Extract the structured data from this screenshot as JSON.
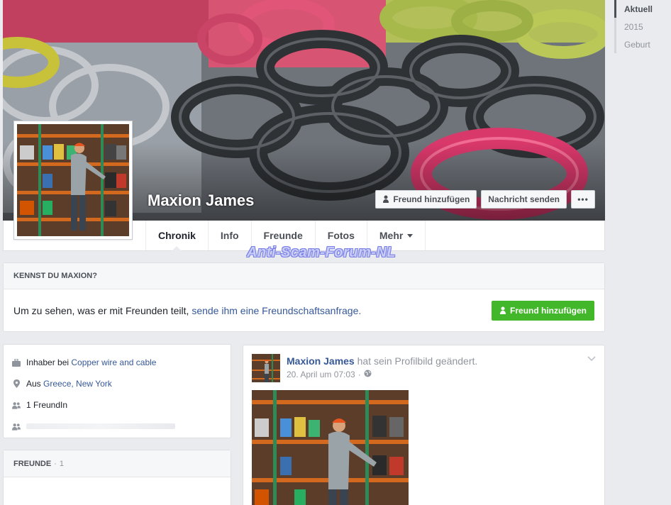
{
  "profile": {
    "name": "Maxion James"
  },
  "cover_actions": {
    "add_friend": "Freund hinzufügen",
    "send_message": "Nachricht senden",
    "more": "•••"
  },
  "nav": {
    "tabs": [
      {
        "label": "Chronik"
      },
      {
        "label": "Info"
      },
      {
        "label": "Freunde"
      },
      {
        "label": "Fotos"
      },
      {
        "label": "Mehr"
      }
    ]
  },
  "watermark": "Anti-Scam-Forum-NL",
  "scrubber": {
    "items": [
      "Aktuell",
      "2015",
      "Geburt"
    ]
  },
  "know_card": {
    "heading": "KENNST DU MAXION?",
    "text": "Um zu sehen, was er mit Freunden teilt,",
    "link": "sende ihm eine Freundschaftsanfrage.",
    "button": "Freund hinzufügen"
  },
  "intro": {
    "work_prefix": "Inhaber bei",
    "work_link": "Copper wire and cable",
    "from_prefix": "Aus",
    "from_link": "Greece, New York",
    "friends_line": "1 FreundIn"
  },
  "friends_card": {
    "heading": "FREUNDE",
    "separator": "·",
    "count": "1"
  },
  "post": {
    "author": "Maxion James",
    "action": "hat sein Profilbild geändert.",
    "date": "20. April um 07:03",
    "separator": "·"
  },
  "colors": {
    "link": "#365899",
    "green_button": "#42b72a",
    "page_bg": "#e9ebee"
  },
  "icons": {
    "chevron": "chevron-down-icon",
    "privacy": "globe-icon",
    "work": "briefcase-icon",
    "location": "location-pin-icon",
    "friends": "friends-icon"
  }
}
